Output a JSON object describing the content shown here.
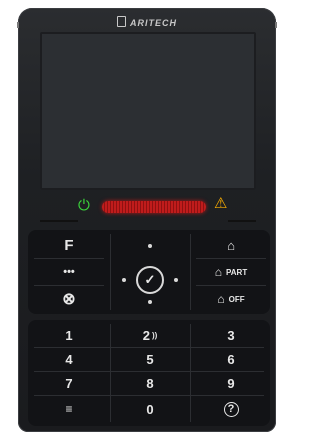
{
  "brand": {
    "name": "ARITECH"
  },
  "indicators": {
    "power": "⏻",
    "warning": "⚠"
  },
  "function_keys": {
    "f_label": "F",
    "more_label": "•••",
    "cancel_symbol": "⊗",
    "home_symbol": "⌂",
    "part_label": "PART",
    "part_symbol": "⌂",
    "off_label": "OFF",
    "off_symbol": "⌂",
    "ok_symbol": "✓"
  },
  "keypad": [
    {
      "label": "1"
    },
    {
      "label": "2",
      "extra": "))"
    },
    {
      "label": "3"
    },
    {
      "label": "4"
    },
    {
      "label": "5"
    },
    {
      "label": "6"
    },
    {
      "label": "7"
    },
    {
      "label": "8"
    },
    {
      "label": "9"
    },
    {
      "label": "≡"
    },
    {
      "label": "0"
    },
    {
      "label": "?"
    }
  ]
}
